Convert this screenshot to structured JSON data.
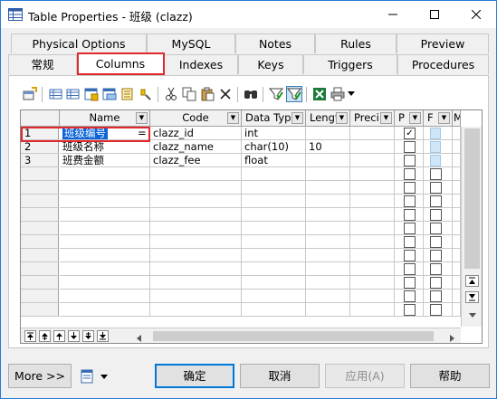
{
  "window": {
    "title": "Table Properties - 班级 (clazz)",
    "icon": "table-icon",
    "controls": [
      "minimize-icon",
      "maximize-icon",
      "close-icon"
    ]
  },
  "tabs": {
    "row1": [
      "Physical Options",
      "MySQL",
      "Notes",
      "Rules",
      "Preview"
    ],
    "row2": [
      "常规",
      "Columns",
      "Indexes",
      "Keys",
      "Triggers",
      "Procedures"
    ],
    "active": "Columns"
  },
  "toolbar": {
    "icons": [
      "properties-icon",
      "insert-row-icon",
      "add-row-icon",
      "add-columns-icon",
      "reuse-columns-icon",
      "add-attributes-icon",
      "cut-icon",
      "copy-icon",
      "paste-icon",
      "delete-icon",
      "find-icon",
      "filter-icon",
      "filter-active-icon",
      "excel-export-icon",
      "print-icon",
      "dropdown-arrow-icon"
    ]
  },
  "grid": {
    "columns": [
      "Name",
      "Code",
      "Data Typ",
      "Lengt",
      "Preci",
      "P",
      "F",
      "M"
    ],
    "rows": [
      {
        "num": "1",
        "name": "班级编号",
        "code": "clazz_id",
        "type": "int",
        "length": "",
        "precision": "",
        "p": true,
        "f": true,
        "name_suffix": "="
      },
      {
        "num": "2",
        "name": "班级名称",
        "code": "clazz_name",
        "type": "char(10)",
        "length": "10",
        "precision": "",
        "p": false,
        "f": true
      },
      {
        "num": "3",
        "name": "班费金额",
        "code": "clazz_fee",
        "type": "float",
        "length": "",
        "precision": "",
        "p": false,
        "f": true
      }
    ]
  },
  "buttons": {
    "more": "More >>",
    "ok": "确定",
    "cancel": "取消",
    "apply": "应用(A)",
    "help": "帮助"
  },
  "colors": {
    "selection": "#0a64d8",
    "highlight_border": "#e0282d",
    "title_border": "#2b79d8"
  }
}
